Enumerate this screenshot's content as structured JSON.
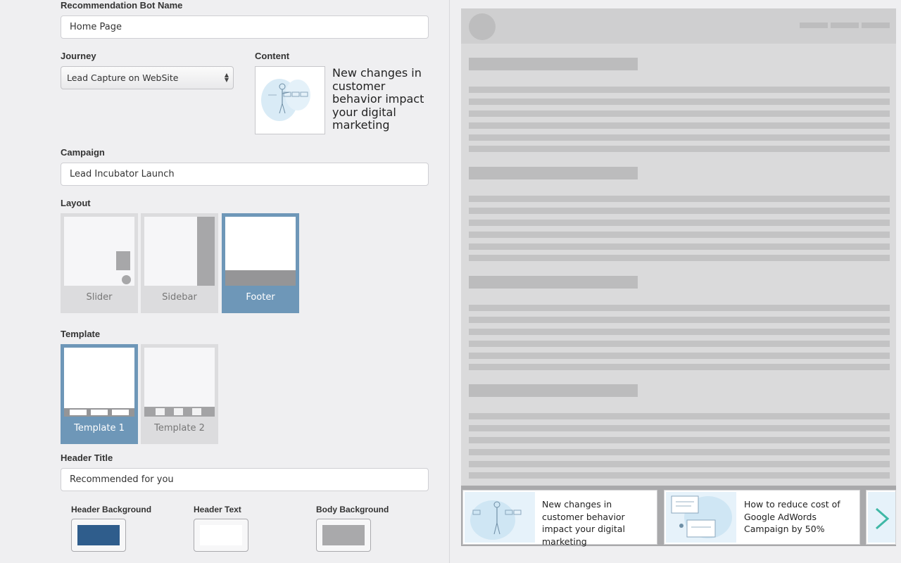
{
  "form": {
    "bot_name_label": "Recommendation Bot Name",
    "bot_name_value": "Home Page",
    "journey_label": "Journey",
    "journey_value": "Lead Capture on WebSite",
    "content_label": "Content",
    "content_title": "New changes in customer behavior impact your digital marketing",
    "campaign_label": "Campaign",
    "campaign_value": "Lead Incubator Launch",
    "layout_label": "Layout",
    "layouts": [
      {
        "label": "Slider",
        "selected": false
      },
      {
        "label": "Sidebar",
        "selected": false
      },
      {
        "label": "Footer",
        "selected": true
      }
    ],
    "template_label": "Template",
    "templates": [
      {
        "label": "Template 1",
        "selected": true
      },
      {
        "label": "Template 2",
        "selected": false
      }
    ],
    "header_title_label": "Header Title",
    "header_title_value": "Recommended for you",
    "header_bg_label": "Header Background",
    "header_text_label": "Header Text",
    "body_bg_label": "Body Background",
    "colors": {
      "header_background": "#2f5d8c",
      "header_text": "#ffffff",
      "body_background": "#a9a9ab",
      "selected_tile": "#6e97b8"
    }
  },
  "preview": {
    "cards": [
      {
        "text": "New changes in customer behavior impact your digital marketing"
      },
      {
        "text": "How to reduce cost of Google AdWords Campaign by 50%"
      }
    ],
    "next_icon": "chevron-right-icon"
  }
}
